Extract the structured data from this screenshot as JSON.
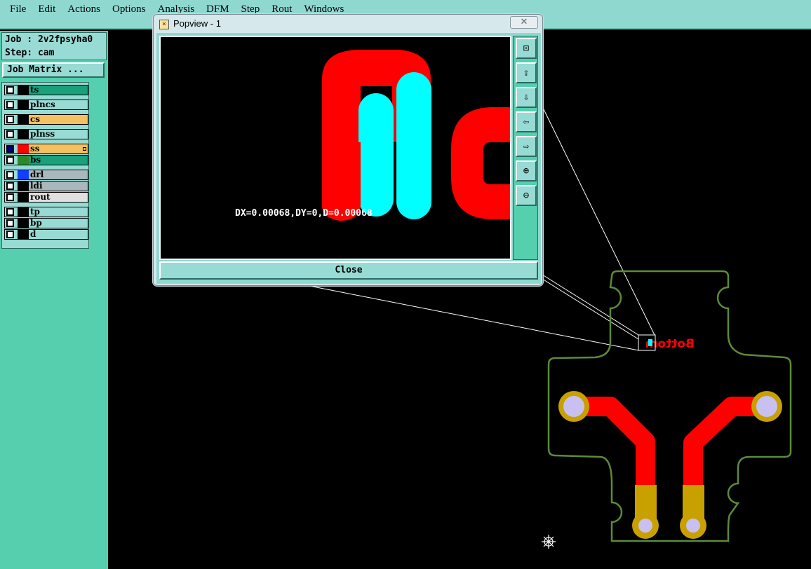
{
  "menubar": {
    "items": [
      {
        "label": "File"
      },
      {
        "label": "Edit"
      },
      {
        "label": "Actions"
      },
      {
        "label": "Options"
      },
      {
        "label": "Analysis"
      },
      {
        "label": "DFM"
      },
      {
        "label": "Step"
      },
      {
        "label": "Rout"
      },
      {
        "label": "Windows"
      }
    ]
  },
  "job": {
    "job_line": "Job : 2v2fpsyha0",
    "step_line": "Step: cam",
    "matrix_button": "Job Matrix ..."
  },
  "layers": [
    {
      "name": "ts",
      "color": "#1aa07a",
      "swatch": "#000000",
      "checked": false
    },
    {
      "name": "plncs",
      "color": "#98dbd4",
      "swatch": "#000000",
      "checked": false
    },
    {
      "name": "cs",
      "color": "#f5c060",
      "swatch": "#000000",
      "checked": false
    },
    {
      "name": "plnss",
      "color": "#98dbd4",
      "swatch": "#000000",
      "checked": false
    },
    {
      "name": "ss",
      "color": "#f5c060",
      "swatch": "#ff0000",
      "checked": true
    },
    {
      "name": "bs",
      "color": "#1aa07a",
      "swatch": "#2a8a2a",
      "checked": false
    },
    {
      "name": "drl",
      "color": "#a8b8bc",
      "swatch": "#1040ff",
      "checked": false
    },
    {
      "name": "ldi",
      "color": "#a8b8bc",
      "swatch": "#000000",
      "checked": false
    },
    {
      "name": "rout",
      "color": "#e0e0e0",
      "swatch": "#000000",
      "checked": false
    },
    {
      "name": "tp",
      "color": "#98dbd4",
      "swatch": "#000000",
      "checked": false
    },
    {
      "name": "bp",
      "color": "#98dbd4",
      "swatch": "#000000",
      "checked": false
    },
    {
      "name": "d",
      "color": "#98dbd4",
      "swatch": "#000000",
      "checked": false
    }
  ],
  "popview": {
    "title": "Popview - 1",
    "close_x": "✕",
    "measurement": "DX=0.00068,DY=0,D=0.00068",
    "close_button": "Close",
    "tools": [
      "zoom-fit-icon",
      "pan-up-icon",
      "pan-down-icon",
      "pan-left-icon",
      "pan-right-icon",
      "zoom-in-icon",
      "zoom-out-icon"
    ]
  },
  "board": {
    "silk_text": "Bottom",
    "colors": {
      "outline": "#5c8a3a",
      "copper": "#ff0000",
      "pad": "#c8a000",
      "hole": "#c8c0f0",
      "silk": "#ff0000"
    }
  }
}
